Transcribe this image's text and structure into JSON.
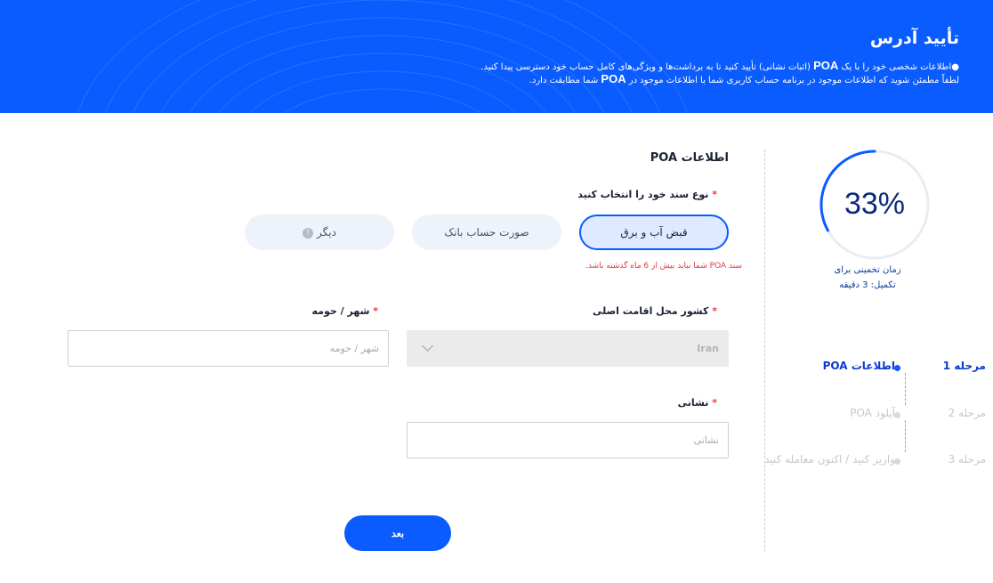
{
  "header": {
    "title": "تأیید آدرس",
    "line1_pre": "●اطلاعات شخصی خود را با یک ",
    "line1_poa": "POA",
    "line1_post": " (اثبات نشانی) تأیید کنید تا به برداشت‌ها و ویژگی‌های کامل حساب خود دسترسی پیدا کنید.",
    "line2_pre": "لطفاً مطمئن شوید که اطلاعات موجود در برنامه حساب کاربری شما با اطلاعات موجود در ",
    "line2_poa": "POA",
    "line2_post": " شما مطابقت دارد."
  },
  "progress": {
    "percent_label": "33%",
    "percent": 33,
    "eta_line1": "زمان تخمینی برای",
    "eta_line2": "تکمیل: 3 دقیقه"
  },
  "steps": [
    {
      "num": "مرحله 1",
      "label": "اطلاعات POA",
      "active": true
    },
    {
      "num": "مرحله 2",
      "label": "آپلود POA",
      "active": false
    },
    {
      "num": "مرحله 3",
      "label": "واریز کنید / اکنون معامله کنید",
      "active": false
    }
  ],
  "form": {
    "section_title": "اطلاعات POA",
    "doc_type_label": "نوع سند خود را انتخاب کنید",
    "required_mark": "*",
    "options": [
      {
        "label": "قبض آب و برق",
        "selected": true
      },
      {
        "label": "صورت حساب بانک",
        "selected": false
      },
      {
        "label": "دیگر",
        "selected": false
      }
    ],
    "info_glyph": "!",
    "error_text": "سند POA شما نباید بیش از 6 ماه گذشته باشد.",
    "country_label": "کشور محل اقامت اصلی",
    "country_value": "Iran",
    "city_label": "شهر / حومه",
    "city_placeholder": "شهر / حومه",
    "address_label": "نشانی",
    "address_placeholder": "نشانی",
    "next_label": "بعد"
  },
  "colors": {
    "accent": "#0a5cff",
    "error": "#e23b3b"
  }
}
